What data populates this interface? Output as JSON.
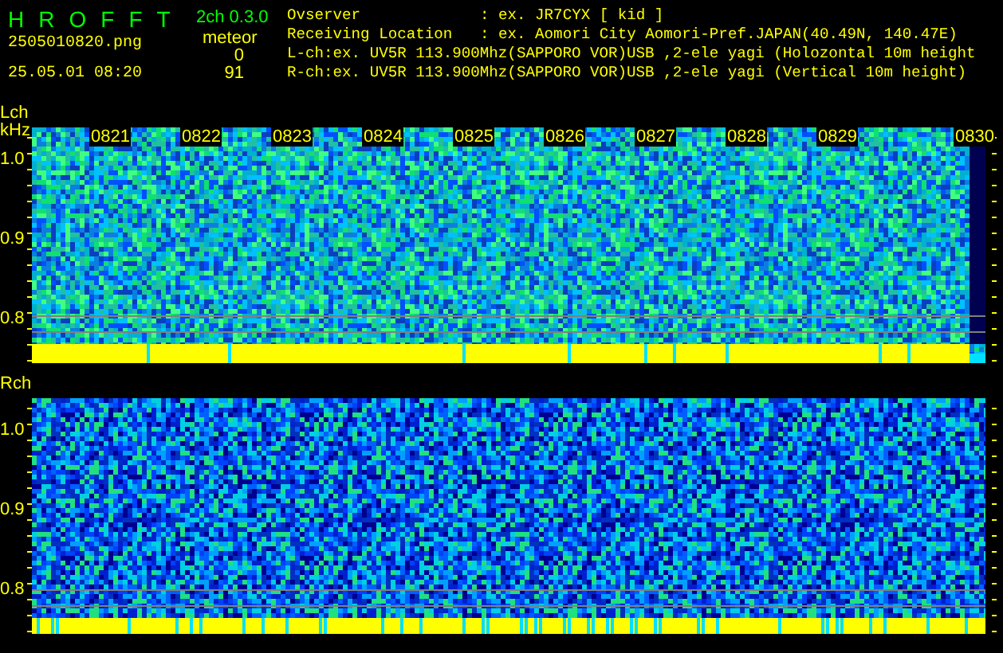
{
  "header": {
    "title_letters": [
      "H",
      "R",
      "O",
      "F",
      "F",
      "T"
    ],
    "version": "2ch 0.3.0",
    "file": "2505010820.png",
    "datetime": "25.05.01 08:20",
    "meteor_label": "meteor",
    "meteor_counts": [
      "0",
      "91"
    ]
  },
  "info": [
    {
      "label": "Ovserver",
      "value": ": ex. JR7CYX [ kid ]"
    },
    {
      "label": "Receiving Location",
      "value": ": ex. Aomori City Aomori-Pref.JAPAN(40.49N, 140.47E)"
    },
    {
      "label": "L-ch:",
      "value": "ex. UV5R 113.900Mhz(SAPPORO VOR)USB ,2-ele yagi (Holozontal 10m height"
    },
    {
      "label": "R-ch:",
      "value": "ex. UV5R 113.900Mhz(SAPPORO VOR)USB ,2-ele yagi (Vertical 10m height)"
    }
  ],
  "panels": [
    {
      "label": "Lch",
      "unit": "kHz",
      "times": [
        "0821",
        "0822",
        "0823",
        "0824",
        "0825",
        "0826",
        "0827",
        "0828",
        "0829",
        "0830"
      ],
      "yticks": [
        "1.0",
        "0.9",
        "0.8"
      ]
    },
    {
      "label": "Rch",
      "yticks": [
        "1.0",
        "0.9",
        "0.8"
      ]
    }
  ]
}
